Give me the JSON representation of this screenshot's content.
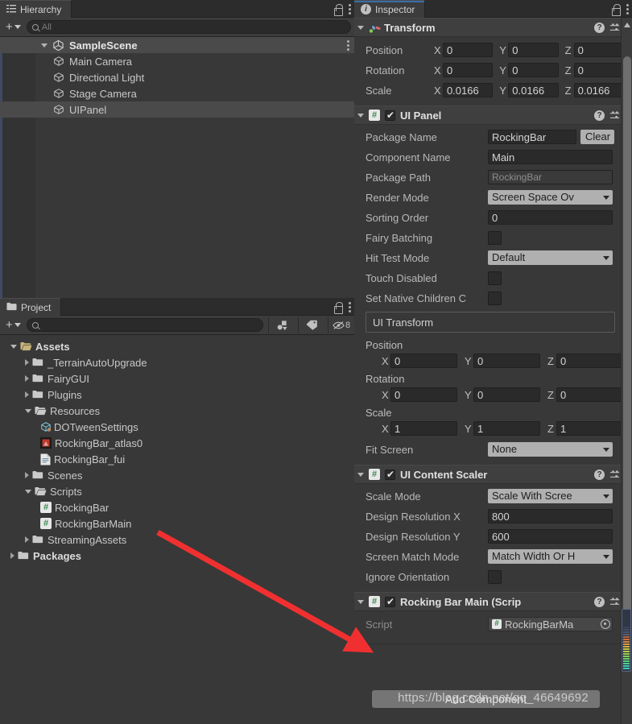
{
  "hierarchy": {
    "tab_label": "Hierarchy",
    "tab_icon": "hierarchy-icon",
    "toolbar": {
      "add_label": "+",
      "search_placeholder": "All",
      "search_value": ""
    },
    "rows": [
      {
        "label": "SampleScene",
        "icon": "unity-scene-icon",
        "depth": 0,
        "expanded": true,
        "selected": false,
        "bold": true
      },
      {
        "label": "Main Camera",
        "icon": "gameobject-cube-icon",
        "depth": 1,
        "expanded": null,
        "selected": false,
        "bold": false
      },
      {
        "label": "Directional Light",
        "icon": "gameobject-cube-icon",
        "depth": 1,
        "expanded": null,
        "selected": false,
        "bold": false
      },
      {
        "label": "Stage Camera",
        "icon": "gameobject-cube-icon",
        "depth": 1,
        "expanded": null,
        "selected": false,
        "bold": false
      },
      {
        "label": "UIPanel",
        "icon": "gameobject-cube-icon",
        "depth": 1,
        "expanded": null,
        "selected": true,
        "bold": false
      }
    ]
  },
  "project": {
    "tab_label": "Project",
    "tab_icon": "folder-icon",
    "toolbar": {
      "add_label": "+",
      "search_placeholder": "",
      "search_value": "",
      "hidden_count": "8"
    },
    "rows": [
      {
        "label": "Assets",
        "icon": "folder-open-icon",
        "depth": 0,
        "arrow": "down",
        "bold": true
      },
      {
        "label": "_TerrainAutoUpgrade",
        "icon": "folder-icon",
        "depth": 1,
        "arrow": "right",
        "bold": false
      },
      {
        "label": "FairyGUI",
        "icon": "folder-icon",
        "depth": 1,
        "arrow": "right",
        "bold": false
      },
      {
        "label": "Plugins",
        "icon": "folder-icon",
        "depth": 1,
        "arrow": "right",
        "bold": false
      },
      {
        "label": "Resources",
        "icon": "folder-open-icon",
        "depth": 1,
        "arrow": "down",
        "bold": false
      },
      {
        "label": "DOTweenSettings",
        "icon": "prefab-icon",
        "depth": 2,
        "arrow": "none",
        "bold": false
      },
      {
        "label": "RockingBar_atlas0",
        "icon": "texture-icon",
        "depth": 2,
        "arrow": "none",
        "bold": false
      },
      {
        "label": "RockingBar_fui",
        "icon": "textasset-icon",
        "depth": 2,
        "arrow": "none",
        "bold": false
      },
      {
        "label": "Scenes",
        "icon": "folder-icon",
        "depth": 1,
        "arrow": "right",
        "bold": false
      },
      {
        "label": "Scripts",
        "icon": "folder-open-icon",
        "depth": 1,
        "arrow": "down",
        "bold": false
      },
      {
        "label": "RockingBar",
        "icon": "csharp-script-icon",
        "depth": 2,
        "arrow": "none",
        "bold": false
      },
      {
        "label": "RockingBarMain",
        "icon": "csharp-script-icon",
        "depth": 2,
        "arrow": "none",
        "bold": false
      },
      {
        "label": "StreamingAssets",
        "icon": "folder-icon",
        "depth": 1,
        "arrow": "right",
        "bold": false
      },
      {
        "label": "Packages",
        "icon": "folder-icon",
        "depth": 0,
        "arrow": "right",
        "bold": true
      }
    ]
  },
  "inspector": {
    "tab_label": "Inspector",
    "tab_icon": "info-icon",
    "components": [
      {
        "title": "Transform",
        "icon": "transform-icon",
        "has_checkbox": false,
        "vectors": [
          {
            "label": "Position",
            "x": "0",
            "y": "0",
            "z": "0"
          },
          {
            "label": "Rotation",
            "x": "0",
            "y": "0",
            "z": "0"
          },
          {
            "label": "Scale",
            "x": "0.0166",
            "y": "0.0166",
            "z": "0.0166"
          }
        ]
      },
      {
        "title": "UI Panel",
        "icon": "csharp-script-icon",
        "has_checkbox": true,
        "checked": true,
        "fields": [
          {
            "label": "Package Name",
            "type": "text",
            "value": "RockingBar",
            "button": "Clear"
          },
          {
            "label": "Component Name",
            "type": "text",
            "value": "Main"
          },
          {
            "label": "Package Path",
            "type": "readonly",
            "value": "RockingBar"
          },
          {
            "label": "Render Mode",
            "type": "popup",
            "value": "Screen Space Ov"
          },
          {
            "label": "Sorting Order",
            "type": "text",
            "value": "0"
          },
          {
            "label": "Fairy Batching",
            "type": "checkbox",
            "value": false
          },
          {
            "label": "Hit Test Mode",
            "type": "popup",
            "value": "Default"
          },
          {
            "label": "Touch Disabled",
            "type": "checkbox",
            "value": false
          },
          {
            "label": "Set Native Children C",
            "type": "checkbox",
            "value": false
          }
        ],
        "sub_panel": {
          "title": "UI Transform",
          "vectors": [
            {
              "label": "Position",
              "x": "0",
              "y": "0",
              "z": "0"
            },
            {
              "label": "Rotation",
              "x": "0",
              "y": "0",
              "z": "0"
            },
            {
              "label": "Scale",
              "x": "1",
              "y": "1",
              "z": "1"
            }
          ],
          "fit_screen_label": "Fit Screen",
          "fit_screen_value": "None"
        }
      },
      {
        "title": "UI Content Scaler",
        "icon": "csharp-script-icon",
        "has_checkbox": true,
        "checked": true,
        "fields": [
          {
            "label": "Scale Mode",
            "type": "popup",
            "value": "Scale With Scree"
          },
          {
            "label": "Design Resolution X",
            "type": "text",
            "value": "800"
          },
          {
            "label": "Design Resolution Y",
            "type": "text",
            "value": "600"
          },
          {
            "label": "Screen Match Mode",
            "type": "popup",
            "value": "Match Width Or H"
          },
          {
            "label": "Ignore Orientation",
            "type": "checkbox",
            "value": false
          }
        ]
      },
      {
        "title": "Rocking Bar Main (Scrip",
        "icon": "csharp-script-icon",
        "has_checkbox": true,
        "checked": true,
        "fields": [
          {
            "label": "Script",
            "type": "object",
            "value": "RockingBarMa"
          }
        ]
      }
    ],
    "add_component_label": "Add Component"
  },
  "annotation": {
    "arrow_color": "#f03030",
    "watermark": "https://blog.csdn.net/qq_46649692"
  },
  "colors": {
    "window_bg": "#383838",
    "panel_header": "#3c3c3c",
    "accent_blue": "#3a6ea5",
    "selection": "#4a4a4a",
    "field_bg": "#2a2a2a",
    "popup_bg": "#b0b0b0"
  }
}
